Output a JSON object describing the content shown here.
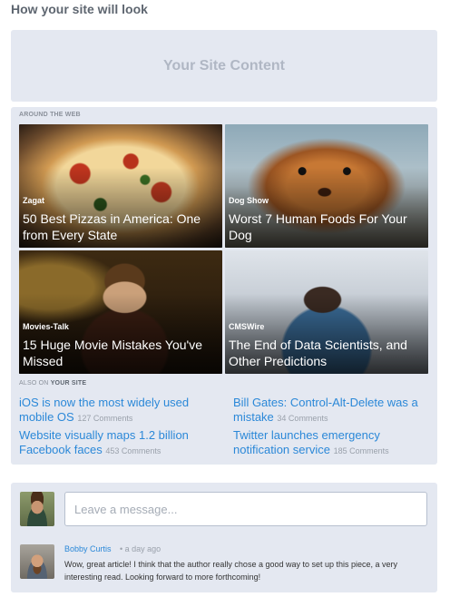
{
  "heading": "How your site will look",
  "site_content_label": "Your Site Content",
  "widget": {
    "section_label": "AROUND THE WEB",
    "cards": [
      {
        "source": "Zagat",
        "title": "50 Best Pizzas in America: One from Every State",
        "image": "pizza-photo"
      },
      {
        "source": "Dog Show",
        "title": "Worst 7 Human Foods For Your Dog",
        "image": "dog-photo"
      },
      {
        "source": "Movies-Talk",
        "title": "15 Huge Movie Mistakes You've Missed",
        "image": "movie-still-photo"
      },
      {
        "source": "CMSWire",
        "title": "The End of Data Scientists, and Other Predictions",
        "image": "stressed-man-photo"
      }
    ],
    "own_label_prefix": "ALSO ON",
    "own_label_site": "YOUR SITE",
    "own_links": [
      {
        "title": "iOS is now the most widely used mobile OS",
        "count": "127 Comments"
      },
      {
        "title": "Bill Gates: Control-Alt-Delete was a mistake",
        "count": "34 Comments"
      },
      {
        "title": "Website visually maps 1.2 billion Facebook faces",
        "count": "453 Comments"
      },
      {
        "title": "Twitter launches emergency notification service",
        "count": "185 Comments"
      }
    ]
  },
  "comments": {
    "input_placeholder": "Leave a message...",
    "items": [
      {
        "author": "Bobby Curtis",
        "time": "• a day ago",
        "text": "Wow, great article! I think that the author really chose a good way to set up this piece, a very interesting read. Looking forward to more forthcoming!"
      }
    ]
  },
  "colors": {
    "panel_bg": "#e4e8f1",
    "link": "#2b88d8",
    "muted": "#9aa1ab"
  }
}
